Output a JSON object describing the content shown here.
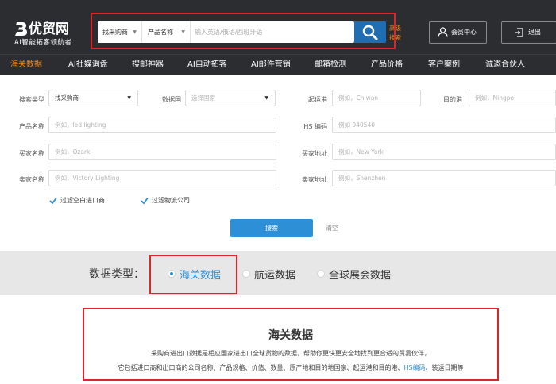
{
  "brand": {
    "name": "优贸网",
    "tagline": "AI智能拓客领航者",
    "logo_icon": "b-logo-icon",
    "accent": "#f08a24",
    "primary_blue": "#2d8fd5",
    "header_bg": "#2b2d31"
  },
  "search": {
    "type_label": "找采购商",
    "field_label": "产品名称",
    "placeholder": "输入英语/俄语/西班牙语",
    "advanced_label": "高级搜索",
    "button_icon": "search-icon"
  },
  "account": {
    "member_label": "会员中心",
    "logout_label": "退出"
  },
  "nav": {
    "items": [
      "海关数据",
      "AI社媒询盘",
      "搜邮神器",
      "AI自动拓客",
      "AI邮件营销",
      "邮箱检测",
      "产品价格",
      "客户案例",
      "诚邀合伙人"
    ],
    "active": "海关数据"
  },
  "form": {
    "search_type": {
      "label": "搜索类型",
      "value": "找采购商"
    },
    "country": {
      "label": "数据国",
      "placeholder": "选择国家"
    },
    "origin_port": {
      "label": "起运港",
      "placeholder": "例如，Chiwan"
    },
    "dest_port": {
      "label": "目的港",
      "placeholder": "例如，Ningpo"
    },
    "product": {
      "label": "产品名称",
      "placeholder": "例如，led lighting"
    },
    "hs_code": {
      "label": "HS 编码",
      "placeholder": "例如 940540"
    },
    "buyer": {
      "label": "买家名称",
      "placeholder": "例如，Ozark"
    },
    "buyer_address": {
      "label": "买家地址",
      "placeholder": "例如，New York"
    },
    "seller": {
      "label": "卖家名称",
      "placeholder": "例如，Victory Lighting"
    },
    "seller_address": {
      "label": "卖家地址",
      "placeholder": "例如，Shenzhen"
    },
    "filter_empty": {
      "label": "过滤空白进口商",
      "checked": true
    },
    "filter_logistics": {
      "label": "过滤物流公司",
      "checked": true
    },
    "submit_label": "搜索",
    "clear_label": "清空"
  },
  "data_type": {
    "title": "数据类型：",
    "options": [
      "海关数据",
      "航运数据",
      "全球展会数据"
    ],
    "selected": "海关数据"
  },
  "description": {
    "title": "海关数据",
    "line1": "采购商进出口数据是相应国家进出口全球货物的数据，帮助你更快更安全地找到更合适的贸易伙伴，",
    "line2_prefix": "它包括进口商和出口商的公司名称、产品规格、价值、数量、原产地和目的地国家、起运港和目的港、",
    "line2_link": "HS编码",
    "line2_suffix": "、装运日期等"
  }
}
